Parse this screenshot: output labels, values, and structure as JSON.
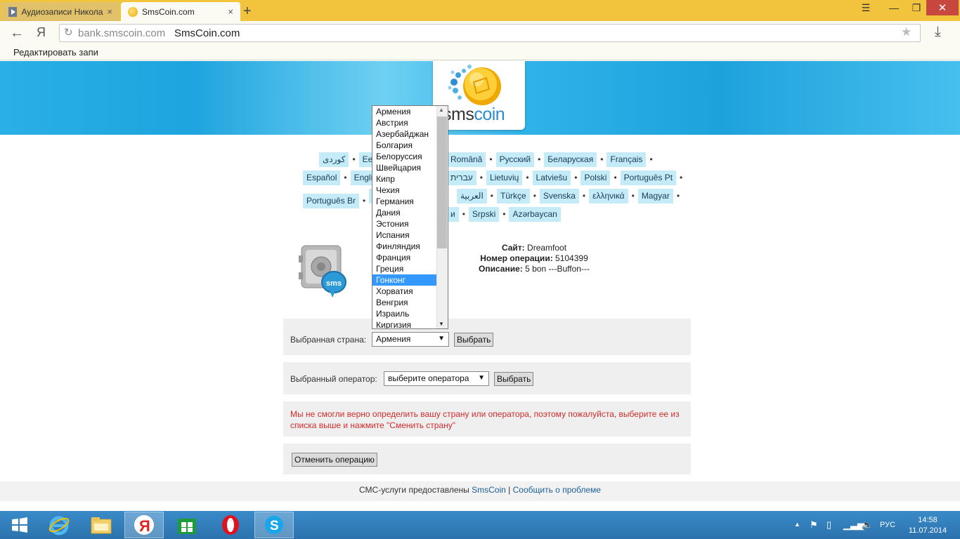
{
  "browser": {
    "tabs": [
      {
        "label": "Аудиозаписи Никола",
        "close": "×"
      },
      {
        "label": "SmsCoin.com",
        "close": "×"
      }
    ],
    "new_tab": "+",
    "address": {
      "host": "bank.smscoin.com",
      "title": "SmsCoin.com"
    },
    "bookmark": "Редактировать запи",
    "ya_label": "Я"
  },
  "logo": {
    "part1": "sms",
    "part2": "coin"
  },
  "languages": {
    "row1": [
      "كوردی",
      "Eesti",
      "Română",
      "Русский",
      "Беларуская",
      "Français"
    ],
    "row2": [
      "Español",
      "English",
      "עברית",
      "Lietuvių",
      "Latviešu",
      "Polski",
      "Português Pt"
    ],
    "row3": [
      "Português Br",
      "",
      "العربية",
      "Türkçe",
      "Svenska",
      "ελληνικά",
      "Magyar"
    ],
    "row4": [
      "",
      "Srpski",
      "Azərbaycan"
    ]
  },
  "details": {
    "site_label": "Сайт:",
    "site_value": "Dreamfoot",
    "op_label": "Номер операции:",
    "op_value": "5104399",
    "desc_label": "Описание:",
    "desc_value": "5 bon ---Buffon---"
  },
  "country": {
    "label": "Выбранная страна:",
    "selected": "Армения",
    "button": "Выбрать",
    "options": [
      "Армения",
      "Австрия",
      "Азербайджан",
      "Болгария",
      "Белоруссия",
      "Швейцария",
      "Кипр",
      "Чехия",
      "Германия",
      "Дания",
      "Эстония",
      "Испания",
      "Финляндия",
      "Франция",
      "Греция",
      "Гонконг",
      "Хорватия",
      "Венгрия",
      "Израиль",
      "Киргизия"
    ],
    "highlighted": "Гонконг"
  },
  "operator": {
    "label": "Выбранный оператор:",
    "selected": "выберите оператора",
    "button": "Выбрать"
  },
  "error_message": "Мы не смогли верно определить вашу страну или оператора, поэтому пожалуйста, выберите ее из списка выше и нажмите \"Сменить страну\"",
  "cancel_button": "Отменить операцию",
  "footer": {
    "prefix": "СМС-услуги предоставлены",
    "link1": "SmsCoin",
    "sep": "|",
    "link2": "Сообщить о проблеме"
  },
  "taskbar": {
    "time": "14:58",
    "date": "11.07.2014",
    "lang": "РУС"
  },
  "colors": {
    "banner": "#1ea4de",
    "lang_bg": "#c4ecf8",
    "error": "#d42b2b",
    "highlight": "#3399ff",
    "taskbar": "#2f7fc0"
  }
}
